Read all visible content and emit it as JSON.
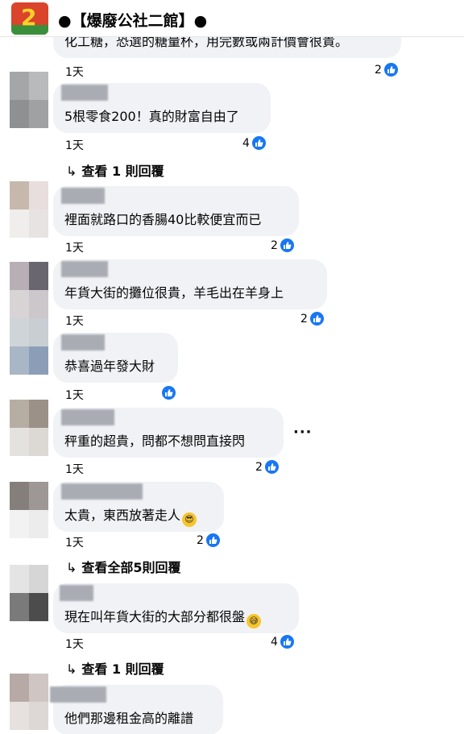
{
  "header": {
    "title": "●【爆廢公社二館】●",
    "logo_text": "2"
  },
  "partial_comment": {
    "text": "化工糖，恐選的糖量杯，用完數或兩計價會很貴。",
    "time": "1天",
    "likes": "2"
  },
  "comments": [
    {
      "text": "5根零食200！真的財富自由了",
      "time": "1天",
      "likes": "4",
      "replies": "查看 1 則回覆",
      "avatar": [
        "#a5a6a8",
        "#b9babc",
        "#8f9092",
        "#a0a1a3"
      ]
    },
    {
      "text": "裡面就路口的香腸40比較便宜而已",
      "time": "1天",
      "likes": "2",
      "replies": "",
      "avatar": [
        "#c7b8ae",
        "#e8dedd",
        "#f0eded",
        "#e6e3e2"
      ]
    },
    {
      "text": "年貨大街的攤位很貴，羊毛出在羊身上",
      "time": "1天",
      "likes": "2",
      "replies": "",
      "avatar": [
        "#b8aeb6",
        "#6a6670",
        "#d8d4d6",
        "#cbc7cb"
      ]
    },
    {
      "text": "恭喜過年發大財",
      "time": "1天",
      "likes": "",
      "replies": "",
      "avatar": [
        "#cfd4d8",
        "#c8ced2",
        "#a8b6c6",
        "#8c9eb7"
      ]
    },
    {
      "text": "秤重的超貴，問都不想問直接閃",
      "time": "1天",
      "likes": "2",
      "replies": "",
      "avatar": [
        "#b6ada3",
        "#9b9189",
        "#e4e2df",
        "#dcd9d5"
      ]
    },
    {
      "text": "太貴，東西放著走人",
      "time": "1天",
      "likes": "2",
      "replies": "查看全部5則回覆",
      "avatar": [
        "#857f7c",
        "#9d9795",
        "#f2f2f2",
        "#ececec"
      ]
    },
    {
      "text": "現在叫年貨大街的大部分都很盤",
      "time": "1天",
      "likes": "4",
      "replies": "查看 1 則回覆",
      "avatar": [
        "#e4e4e4",
        "#d6d6d6",
        "#7a7a7a",
        "#4c4c4c"
      ]
    },
    {
      "text": "他們那邊租金高的離譜",
      "time": "",
      "likes": "",
      "replies": "",
      "avatar": [
        "#b7a9a6",
        "#cfc5c3",
        "#e6e0df",
        "#ddd7d6"
      ]
    }
  ],
  "more_options": "···",
  "colors": {
    "like_blue": "#1877f2",
    "bubble_bg": "#f0f2f5"
  }
}
